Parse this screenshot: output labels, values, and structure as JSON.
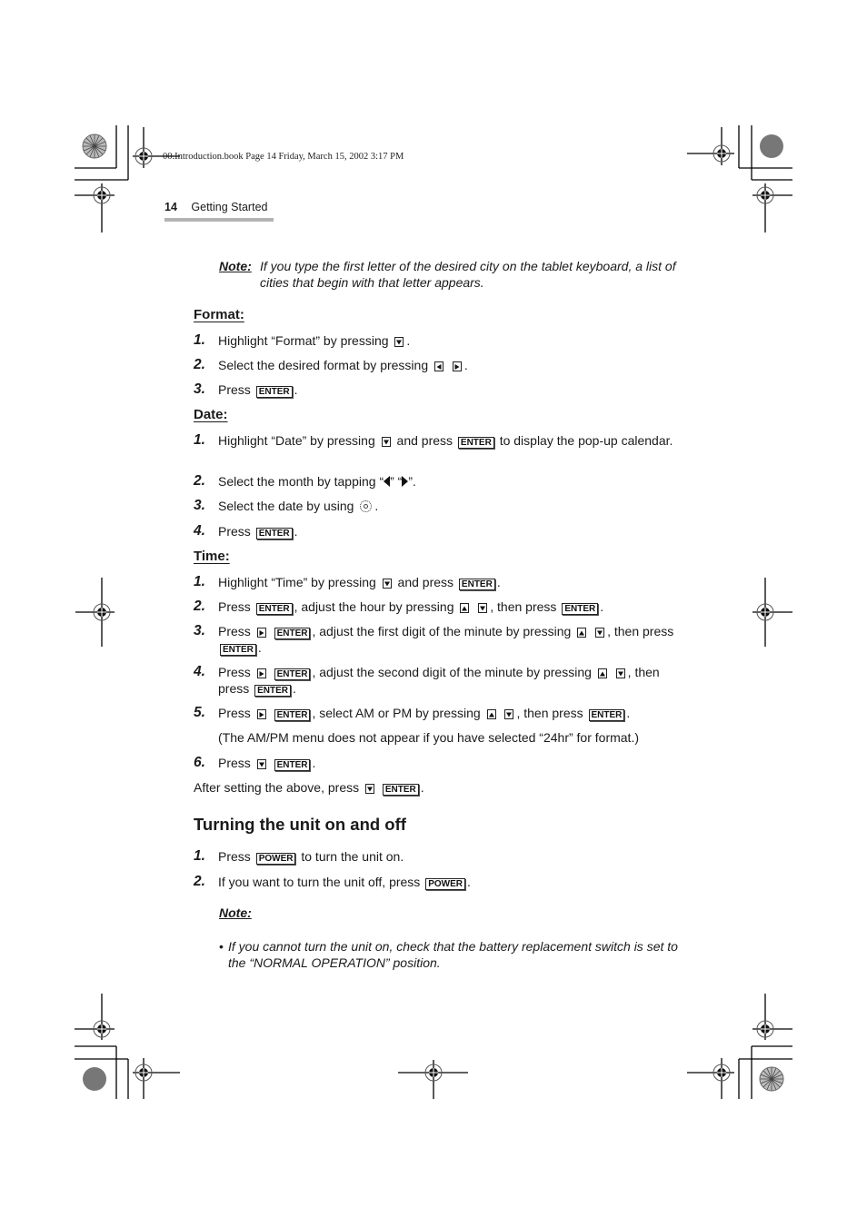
{
  "slug": "00.Introduction.book  Page 14  Friday, March 15, 2002  3:17 PM",
  "running_head": {
    "page_number": "14",
    "section": "Getting Started"
  },
  "intro_note": {
    "label": "Note:",
    "text": "If you type the first letter of the desired city on the tablet keyboard, a list of cities that begin with that letter appears."
  },
  "keys": {
    "enter": "ENTER",
    "power": "POWER"
  },
  "format": {
    "heading": "Format:",
    "steps": [
      {
        "num": "1.",
        "a": "Highlight “Format” by pressing",
        "b": "."
      },
      {
        "num": "2.",
        "a": "Select the desired format by pressing",
        "b": "."
      },
      {
        "num": "3.",
        "a": "Press",
        "b": "."
      }
    ]
  },
  "date": {
    "heading": "Date:",
    "steps": [
      {
        "num": "1.",
        "a": "Highlight “Date” by pressing",
        "b": "and press",
        "c": "to display the pop-up calendar."
      },
      {
        "num": "2.",
        "a": "Select the month by tapping “",
        "b": "” “",
        "c": "”."
      },
      {
        "num": "3.",
        "a": "Select the date by using",
        "b": "."
      },
      {
        "num": "4.",
        "a": "Press",
        "b": "."
      }
    ]
  },
  "time": {
    "heading": "Time:",
    "steps": [
      {
        "num": "1.",
        "a": "Highlight “Time” by pressing",
        "b": "and press",
        "c": "."
      },
      {
        "num": "2.",
        "a": "Press",
        "b": ", adjust the hour by pressing",
        "c": ", then press",
        "d": "."
      },
      {
        "num": "3.",
        "a": "Press",
        "b": ", adjust the first digit of the minute by pressing",
        "c": ", then press",
        "d": "."
      },
      {
        "num": "4.",
        "a": "Press",
        "b": ", adjust the second digit of the minute by pressing",
        "c": ", then press",
        "d": "."
      },
      {
        "num": "5.",
        "a": "Press",
        "b": ", select AM or PM by pressing",
        "c": ", then press",
        "d": "."
      },
      {
        "num": "6.",
        "a": "Press",
        "b": "."
      }
    ],
    "ampm_note": "(The AM/PM menu does not appear if you have selected “24hr” for format.)",
    "after": {
      "a": "After setting the above, press",
      "b": "."
    }
  },
  "power": {
    "heading": "Turning the unit on and off",
    "steps": [
      {
        "num": "1.",
        "a": "Press",
        "b": "to turn the unit on."
      },
      {
        "num": "2.",
        "a": "If you want to turn the unit off, press",
        "b": "."
      }
    ],
    "note_label": "Note:",
    "note_bullet": "•",
    "note_text": "If you cannot turn the unit on, check that the battery replacement switch is set to the “NORMAL OPERATION” position."
  }
}
